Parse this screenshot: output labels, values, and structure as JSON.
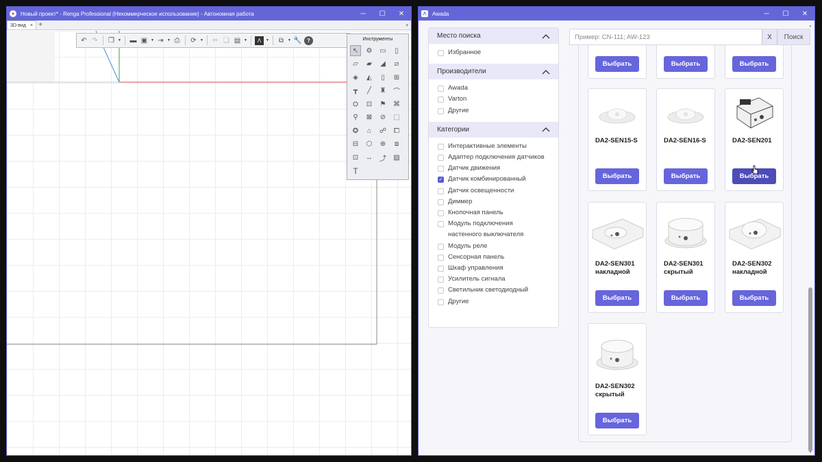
{
  "renga": {
    "title": "Новый проект* - Renga Professional (Некоммерческое использование) - Автономная работа",
    "tab_label": "3D-вид",
    "tab_close": "×",
    "tab_add": "+",
    "tools_title": "Инструменты",
    "text_tool": "T"
  },
  "awada": {
    "title": "Awada",
    "search": {
      "placeholder": "Пример: CN-111; AW-123",
      "clear_label": "X",
      "submit_label": "Поиск"
    },
    "sections": {
      "location": {
        "title": "Место поиска",
        "items": [
          "Избранное"
        ]
      },
      "manufacturers": {
        "title": "Производители",
        "items": [
          "Awada",
          "Varton",
          "Другие"
        ]
      },
      "categories": {
        "title": "Категории",
        "items": [
          "Интерактивные элементы",
          "Адаптер подключения датчиков",
          "Датчик движения",
          "Датчик комбинированный",
          "Датчик освещенности",
          "Диммер",
          "Кнопочная панель",
          "Модуль подключения настенного выключателя",
          "Модуль реле",
          "Сенсорная панель",
          "Шкаф управления",
          "Усилитель сигнала",
          "Светильник светодиодный",
          "Другие"
        ],
        "checked_index": 3
      }
    },
    "select_label": "Выбрать",
    "products": [
      {
        "name": "DA2-SEN15-S"
      },
      {
        "name": "DA2-SEN16-S"
      },
      {
        "name": "DA2-SEN201"
      },
      {
        "name": "DA2-SEN301 накладной"
      },
      {
        "name": "DA2-SEN301 скрытый"
      },
      {
        "name": "DA2-SEN302 накладной"
      },
      {
        "name": "DA2-SEN302 скрытый"
      }
    ]
  },
  "colors": {
    "accent": "#6665dc",
    "titlebar": "#6464d8"
  }
}
